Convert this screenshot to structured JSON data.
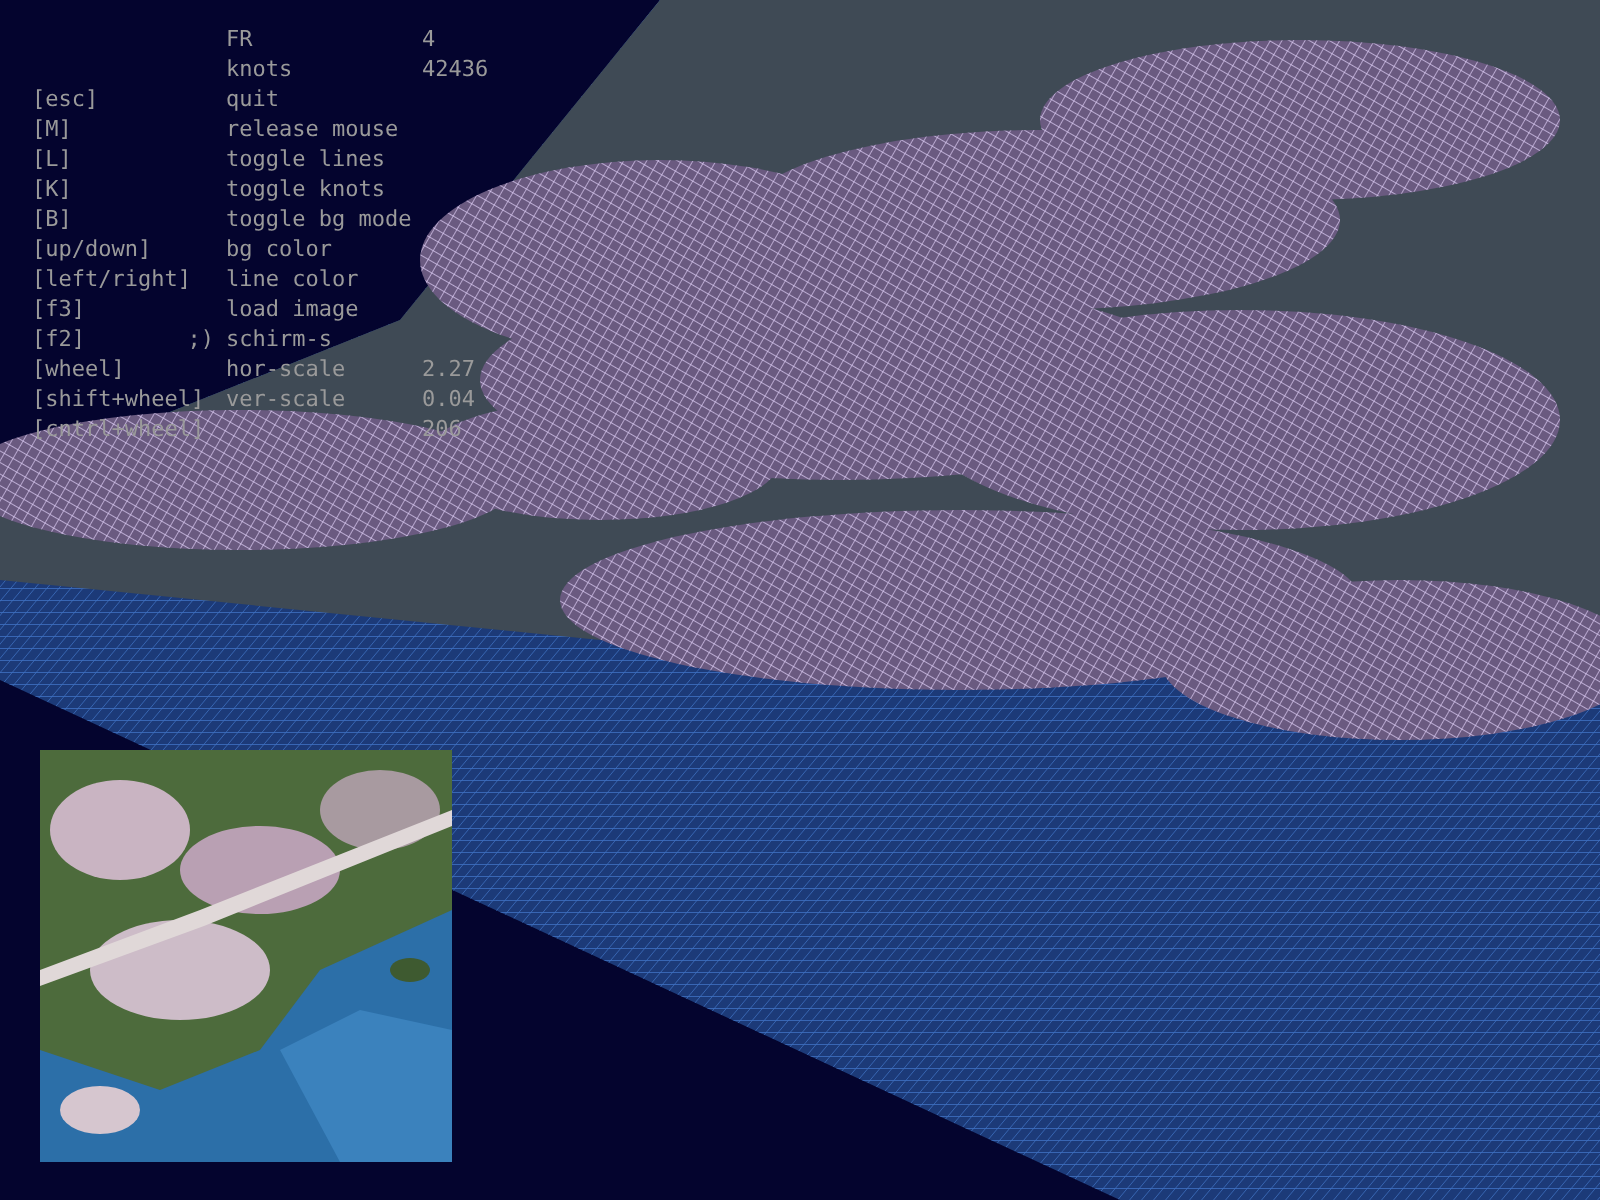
{
  "stats": [
    {
      "label": "FR",
      "value": "4"
    },
    {
      "label": "knots",
      "value": "42436"
    }
  ],
  "keys": [
    {
      "key": "[esc]",
      "action": "quit"
    },
    {
      "key": "[M]",
      "action": "release mouse"
    },
    {
      "key": "[L]",
      "action": "toggle lines"
    },
    {
      "key": "[K]",
      "action": "toggle knots"
    },
    {
      "key": "[B]",
      "action": "toggle bg mode"
    },
    {
      "key": "[up/down]",
      "action": "bg color"
    },
    {
      "key": "[left/right]",
      "action": "line color"
    },
    {
      "key": "[f3]",
      "action": "load image"
    },
    {
      "key": "[f2]",
      "note": ";)",
      "action": "schirm-s"
    },
    {
      "key": "[wheel]",
      "action": "hor-scale",
      "value": "2.27"
    },
    {
      "key": "[shift+wheel]",
      "action": "ver-scale",
      "value": "0.04"
    },
    {
      "key": "[cntrl+wheel]",
      "value": "206"
    }
  ]
}
